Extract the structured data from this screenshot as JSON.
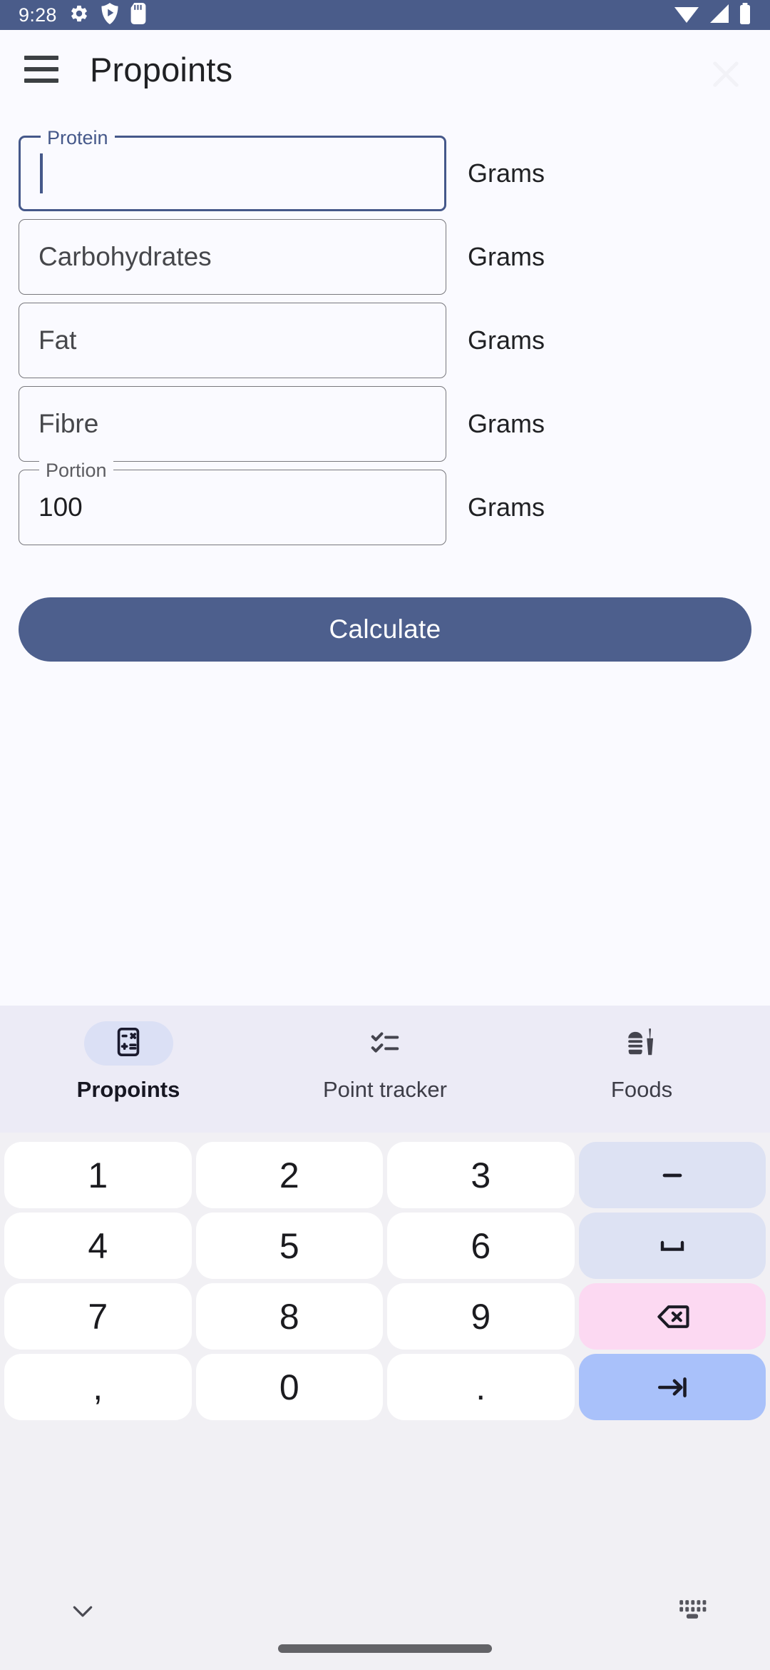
{
  "status_bar": {
    "time": "9:28",
    "left_icons": [
      "gear-icon",
      "play-protect-icon",
      "sd-card-icon"
    ],
    "right_icons": [
      "wifi-icon",
      "cellular-signal-icon",
      "battery-icon"
    ],
    "background_color": "#4a5c8a"
  },
  "app_bar": {
    "menu_icon": "hamburger-menu-icon",
    "title": "Propoints",
    "trailing_icon": "close-icon"
  },
  "form": {
    "unit_label": "Grams",
    "fields": [
      {
        "name": "protein",
        "label": "Protein",
        "value": "",
        "focused": true,
        "unit": "Grams"
      },
      {
        "name": "carbohydrates",
        "label": "Carbohydrates",
        "value": "",
        "focused": false,
        "unit": "Grams"
      },
      {
        "name": "fat",
        "label": "Fat",
        "value": "",
        "focused": false,
        "unit": "Grams"
      },
      {
        "name": "fibre",
        "label": "Fibre",
        "value": "",
        "focused": false,
        "unit": "Grams"
      },
      {
        "name": "portion",
        "label": "Portion",
        "value": "100",
        "focused": false,
        "unit": "Grams"
      }
    ]
  },
  "actions": {
    "calculate_label": "Calculate",
    "calculate_color": "#4d5f8d"
  },
  "bottom_nav": {
    "background_color": "#ecebf6",
    "active_pill_color": "#dbe0f5",
    "items": [
      {
        "label": "Propoints",
        "icon": "calculator-icon",
        "active": true
      },
      {
        "label": "Point tracker",
        "icon": "checklist-icon",
        "active": false
      },
      {
        "label": "Foods",
        "icon": "fast-food-icon",
        "active": false
      }
    ]
  },
  "keyboard": {
    "background_color": "#f1f0f4",
    "key_color": "#ffffff",
    "fn_key_color": "#dde2f3",
    "delete_key_color": "#fcd9f2",
    "go_key_color": "#a9c1fa",
    "rows": [
      [
        {
          "label": "1",
          "type": "digit"
        },
        {
          "label": "2",
          "type": "digit"
        },
        {
          "label": "3",
          "type": "digit"
        },
        {
          "label": "-",
          "type": "fn",
          "icon": "minus-icon"
        }
      ],
      [
        {
          "label": "4",
          "type": "digit"
        },
        {
          "label": "5",
          "type": "digit"
        },
        {
          "label": "6",
          "type": "digit"
        },
        {
          "label": "",
          "type": "fn",
          "icon": "space-icon"
        }
      ],
      [
        {
          "label": "7",
          "type": "digit"
        },
        {
          "label": "8",
          "type": "digit"
        },
        {
          "label": "9",
          "type": "digit"
        },
        {
          "label": "",
          "type": "del",
          "icon": "backspace-icon"
        }
      ],
      [
        {
          "label": ",",
          "type": "digit"
        },
        {
          "label": "0",
          "type": "digit"
        },
        {
          "label": ".",
          "type": "digit"
        },
        {
          "label": "",
          "type": "go",
          "icon": "tab-next-icon"
        }
      ]
    ],
    "hide_icon": "chevron-down-icon",
    "switcher_icon": "keyboard-switch-icon"
  }
}
